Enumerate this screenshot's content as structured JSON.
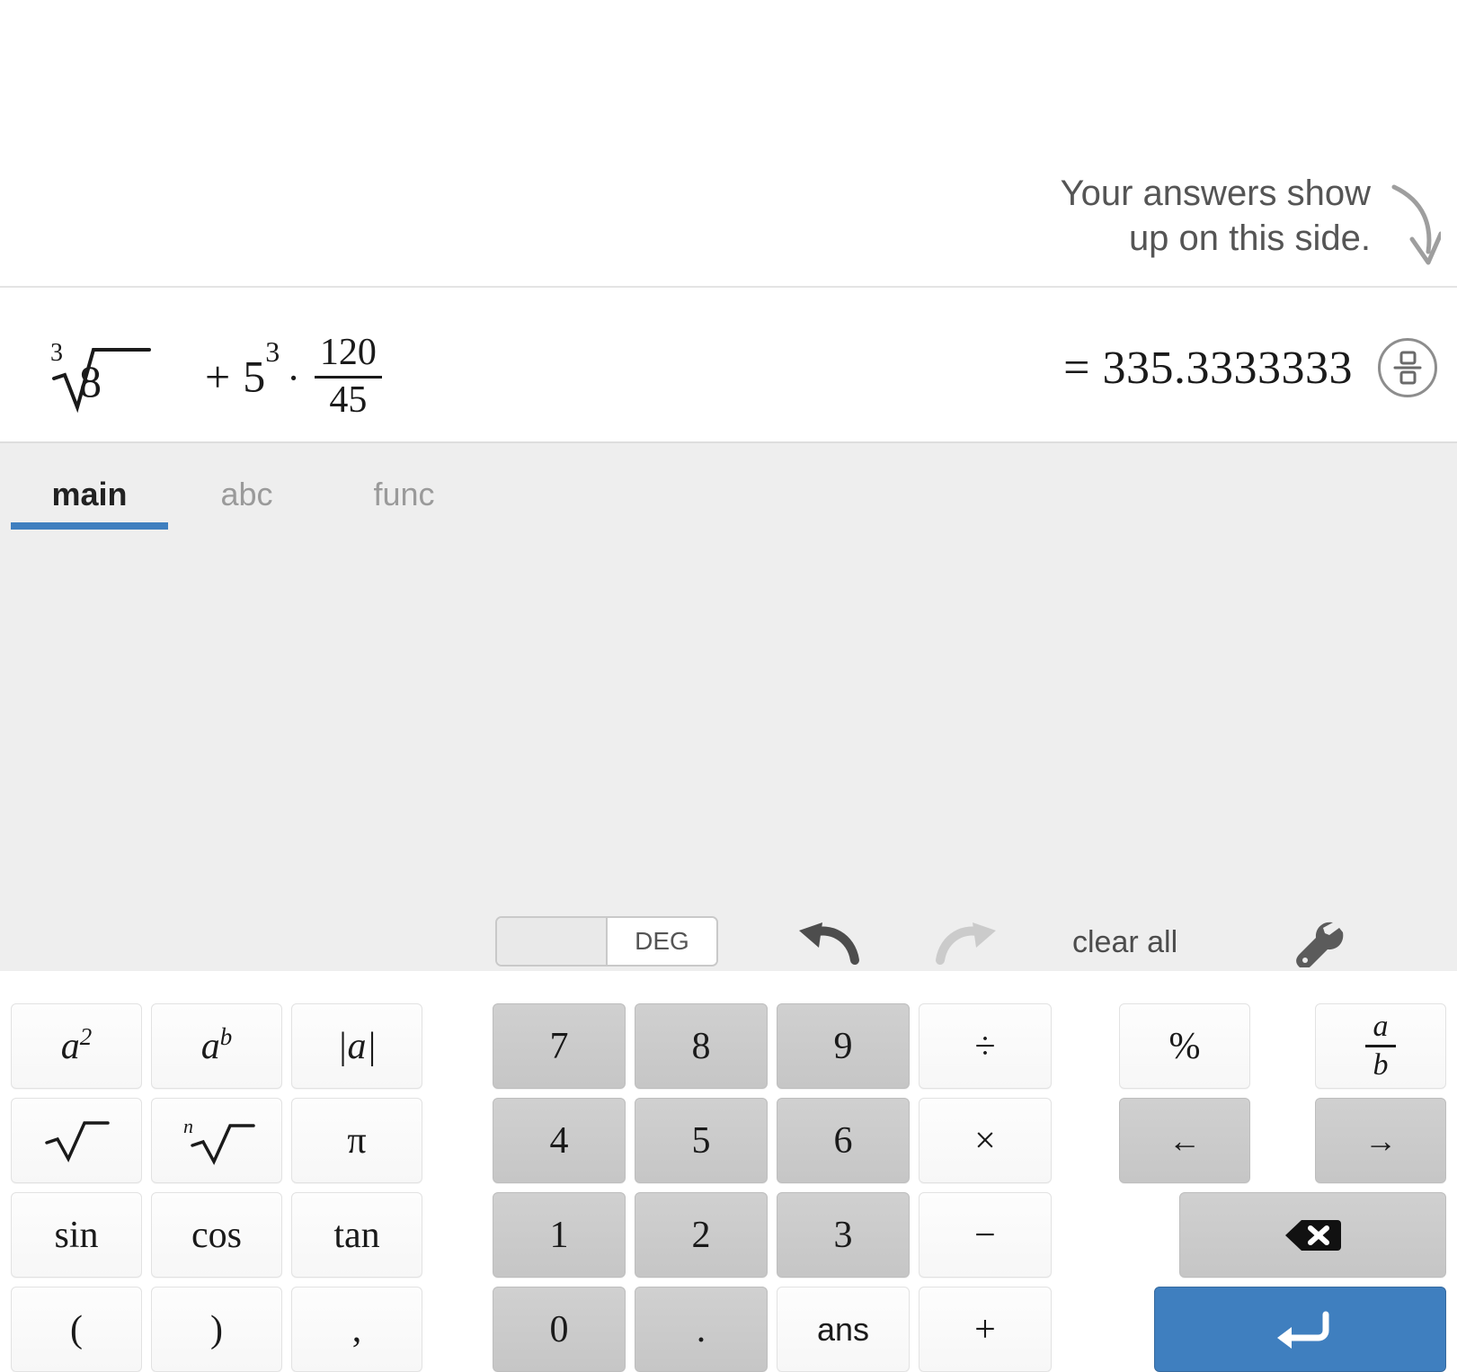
{
  "hint": {
    "text": "Your answers show\nup on this side.",
    "arrow_icon": "curved-down-arrow-icon"
  },
  "expression": {
    "radical_index": "3",
    "radicand": "8",
    "plus": "+",
    "power_base": "5",
    "power_exp": "3",
    "multiply_dot": "·",
    "fraction_numerator": "120",
    "fraction_denominator": "45",
    "full_text": "cbrt(8) + 5^3 · 120/45"
  },
  "answer": {
    "equals_value": "= 335.3333333",
    "toggle_icon": "fraction-toggle-icon"
  },
  "toolbar": {
    "tabs": [
      {
        "label": "main",
        "active": true
      },
      {
        "label": "abc",
        "active": false
      },
      {
        "label": "func",
        "active": false
      }
    ],
    "angle_toggle": {
      "left_label": "",
      "right_label": "DEG",
      "selected": "DEG"
    },
    "undo_icon": "undo-arrow-icon",
    "redo_icon": "redo-arrow-icon",
    "clear_all_label": "clear all",
    "settings_icon": "wrench-icon"
  },
  "keys": {
    "functions": [
      {
        "label": "a2",
        "display": "a",
        "sup": "2",
        "kind": "light",
        "name": "key-square"
      },
      {
        "label": "ab",
        "display": "a",
        "sup": "b",
        "kind": "light",
        "name": "key-power"
      },
      {
        "label": "|a|",
        "display": "|a|",
        "kind": "light",
        "name": "key-abs"
      },
      {
        "label": "sqrt",
        "display": "√",
        "kind": "light",
        "name": "key-sqrt"
      },
      {
        "label": "nthroot",
        "display": "√",
        "presup": "n",
        "kind": "light",
        "name": "key-nth-root"
      },
      {
        "label": "pi",
        "display": "π",
        "kind": "light",
        "name": "key-pi"
      },
      {
        "label": "sin",
        "display": "sin",
        "kind": "light",
        "name": "key-sin"
      },
      {
        "label": "cos",
        "display": "cos",
        "kind": "light",
        "name": "key-cos"
      },
      {
        "label": "tan",
        "display": "tan",
        "kind": "light",
        "name": "key-tan"
      },
      {
        "label": "(",
        "display": "(",
        "kind": "light",
        "name": "key-left-paren"
      },
      {
        "label": ")",
        "display": ")",
        "kind": "light",
        "name": "key-right-paren"
      },
      {
        "label": ",",
        "display": ",",
        "kind": "light",
        "name": "key-comma"
      }
    ],
    "numeric": [
      {
        "label": "7",
        "kind": "dark",
        "name": "key-7"
      },
      {
        "label": "8",
        "kind": "dark",
        "name": "key-8"
      },
      {
        "label": "9",
        "kind": "dark",
        "name": "key-9"
      },
      {
        "label": "÷",
        "kind": "light",
        "name": "key-divide"
      },
      {
        "label": "4",
        "kind": "dark",
        "name": "key-4"
      },
      {
        "label": "5",
        "kind": "dark",
        "name": "key-5"
      },
      {
        "label": "6",
        "kind": "dark",
        "name": "key-6"
      },
      {
        "label": "×",
        "kind": "light",
        "name": "key-multiply"
      },
      {
        "label": "1",
        "kind": "dark",
        "name": "key-1"
      },
      {
        "label": "2",
        "kind": "dark",
        "name": "key-2"
      },
      {
        "label": "3",
        "kind": "dark",
        "name": "key-3"
      },
      {
        "label": "−",
        "kind": "light",
        "name": "key-minus"
      },
      {
        "label": "0",
        "kind": "dark",
        "name": "key-0"
      },
      {
        "label": ".",
        "kind": "dark",
        "name": "key-decimal"
      },
      {
        "label": "ans",
        "kind": "light",
        "name": "key-ans",
        "sans": true
      },
      {
        "label": "+",
        "kind": "light",
        "name": "key-plus"
      }
    ],
    "right": {
      "percent": {
        "label": "%",
        "kind": "light",
        "name": "key-percent"
      },
      "fraction": {
        "numerator": "a",
        "denominator": "b",
        "kind": "light",
        "name": "key-fraction"
      },
      "arrow_left": {
        "label": "←",
        "kind": "dark",
        "name": "key-cursor-left"
      },
      "arrow_right": {
        "label": "→",
        "kind": "dark",
        "name": "key-cursor-right"
      },
      "backspace": {
        "icon": "backspace-icon",
        "kind": "dark",
        "name": "key-backspace"
      },
      "enter": {
        "icon": "enter-arrow-icon",
        "kind": "accent",
        "name": "key-enter"
      }
    }
  },
  "colors": {
    "accent": "#3f7fbf",
    "panel_bg": "#eeeeee",
    "key_dark": "#c9c9c9",
    "key_light": "#fbfbfb",
    "text": "#1a1a1a",
    "muted_text": "#9a9a9a"
  }
}
